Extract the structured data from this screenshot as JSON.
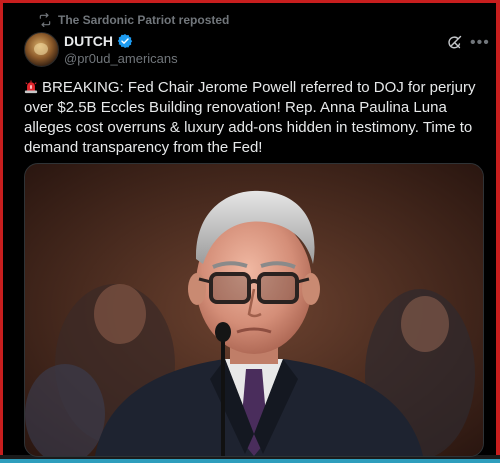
{
  "repost": {
    "label": "The Sardonic Patriot reposted"
  },
  "author": {
    "name": "DUTCH",
    "handle": "@pr0ud_americans"
  },
  "tweet": {
    "text": "BREAKING: Fed Chair Jerome Powell referred to DOJ for perjury over $2.5B Eccles Building renovation! Rep. Anna Paulina Luna alleges cost overruns & luxury add-ons hidden in testimony. Time to demand transparency from the Fed!"
  },
  "icons": {
    "repost": "repost-icon",
    "verified": "verified-badge-icon",
    "grok": "grok-icon",
    "more": "more-icon",
    "siren": "siren-emoji-icon"
  },
  "colors": {
    "accent_blue": "#1d9bf0",
    "frame_red": "#c81e1e",
    "frame_teal": "#2f9ebd"
  }
}
